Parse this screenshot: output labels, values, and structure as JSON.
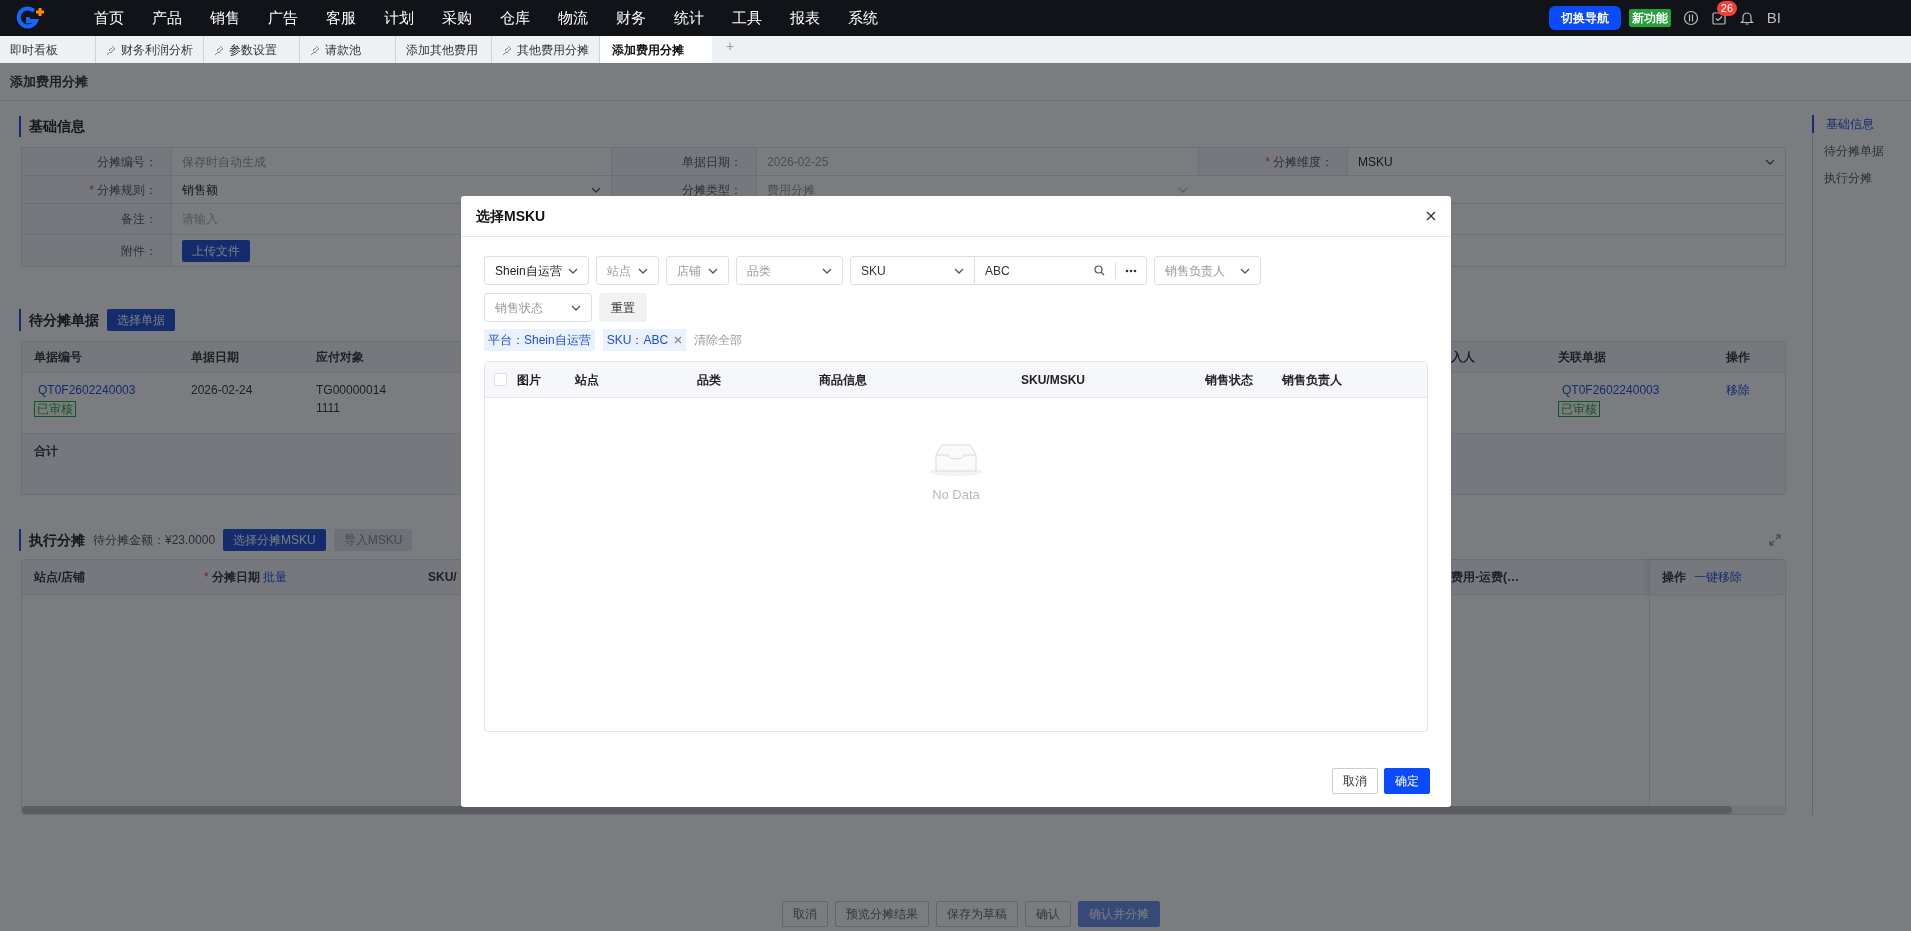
{
  "top_nav": {
    "items": [
      {
        "label": "首页",
        "selected": false
      },
      {
        "label": "产品",
        "selected": false
      },
      {
        "label": "销售",
        "selected": false
      },
      {
        "label": "广告",
        "selected": false
      },
      {
        "label": "客服",
        "selected": false
      },
      {
        "label": "计划",
        "selected": false
      },
      {
        "label": "采购",
        "selected": false
      },
      {
        "label": "仓库",
        "selected": false
      },
      {
        "label": "物流",
        "selected": false
      },
      {
        "label": "财务",
        "selected": false
      },
      {
        "label": "统计",
        "selected": false
      },
      {
        "label": "工具",
        "selected": false
      },
      {
        "label": "报表",
        "selected": false
      },
      {
        "label": "系统",
        "selected": false
      }
    ],
    "switch_button": "切换导航",
    "new_feature": "新功能",
    "notification_count": "26",
    "bi": "BI"
  },
  "tabs": [
    {
      "label": "即时看板",
      "pinned": false,
      "selected": false
    },
    {
      "label": "财务利润分析",
      "pinned": true,
      "selected": false
    },
    {
      "label": "参数设置",
      "pinned": true,
      "selected": false
    },
    {
      "label": "请款池",
      "pinned": true,
      "selected": false
    },
    {
      "label": "添加其他费用",
      "pinned": false,
      "selected": false
    },
    {
      "label": "其他费用分摊",
      "pinned": true,
      "selected": false
    },
    {
      "label": "添加费用分摊",
      "pinned": false,
      "selected": true
    }
  ],
  "add_tab": "+",
  "required_mark": "*",
  "page_title": "添加费用分摊",
  "anchor_nav": [
    {
      "label": "基础信息",
      "selected": true
    },
    {
      "label": "待分摊单据",
      "selected": false
    },
    {
      "label": "执行分摊",
      "selected": false
    }
  ],
  "basic_info": {
    "title": "基础信息",
    "rows": [
      [
        {
          "label": "分摊编号：",
          "kind": "text",
          "value": "保存时自动生成",
          "required": false,
          "disabled": true
        },
        {
          "label": "单据日期：",
          "kind": "text",
          "value": "2026-02-25",
          "required": false,
          "disabled": true
        },
        {
          "label": "分摊维度：",
          "kind": "select",
          "value": "MSKU",
          "required": true,
          "disabled": false
        }
      ],
      [
        {
          "label": "分摊规则：",
          "kind": "select",
          "value": "销售额",
          "required": true,
          "disabled": false
        },
        {
          "label": "分摊类型：",
          "kind": "select",
          "value": "费用分摊",
          "required": false,
          "disabled": true
        }
      ],
      [
        {
          "label": "备注：",
          "kind": "input",
          "placeholder": "请输入",
          "required": false,
          "disabled": false
        }
      ],
      [
        {
          "label": "附件：",
          "kind": "upload",
          "value": "上传文件",
          "required": false,
          "disabled": false
        }
      ]
    ]
  },
  "pending_docs": {
    "title": "待分摊单据",
    "select_button": "选择单据",
    "columns_left": [
      "单据编号",
      "单据日期",
      "应付对象"
    ],
    "columns_right": [
      "入人",
      "关联单据",
      "操作"
    ],
    "rows": [
      {
        "doc_no": "QT0F2602240003",
        "status": "已审核",
        "date": "2026-02-24",
        "payee_lines": [
          "TG00000014",
          "1111"
        ],
        "related_doc": "QT0F2602240003",
        "related_status": "已审核",
        "action": "移除"
      }
    ],
    "total_label": "合计"
  },
  "execute": {
    "title": "执行分摊",
    "amount": "待分摊金额：¥23.0000",
    "select_button": "选择分摊MSKU",
    "import_button": "导入MSKU",
    "columns_left": [
      {
        "label": "站点/店铺",
        "required": false
      },
      {
        "label": "分摊日期",
        "required": true,
        "link": "批量"
      },
      {
        "label": "SKU/",
        "required": false
      }
    ],
    "columns_right": [
      {
        "label": "费用-运费(…",
        "required": false
      }
    ],
    "fixed_column": {
      "label": "操作",
      "link": "一键移除"
    }
  },
  "footer_buttons": [
    {
      "label": "取消",
      "kind": "default"
    },
    {
      "label": "预览分摊结果",
      "kind": "default"
    },
    {
      "label": "保存为草稿",
      "kind": "default"
    },
    {
      "label": "确认",
      "kind": "default"
    },
    {
      "label": "确认并分摊",
      "kind": "primary"
    }
  ],
  "modal": {
    "title": "选择MSKU",
    "filters": [
      {
        "kind": "select",
        "value": "Shein自运营"
      },
      {
        "kind": "select",
        "placeholder": "站点"
      },
      {
        "kind": "select",
        "placeholder": "店铺"
      },
      {
        "kind": "select",
        "placeholder": "品类"
      },
      {
        "kind": "search",
        "field": "SKU",
        "value": "ABC"
      },
      {
        "kind": "select",
        "placeholder": "销售负责人"
      },
      {
        "kind": "select",
        "placeholder": "销售状态"
      }
    ],
    "reset_button": "重置",
    "tags": [
      {
        "label": "平台：Shein自运营",
        "closable": false
      },
      {
        "label": "SKU：ABC",
        "closable": true
      }
    ],
    "clear_all": "清除全部",
    "table": {
      "select_all_checked": false,
      "columns": [
        "图片",
        "站点",
        "品类",
        "商品信息",
        "SKU/MSKU",
        "销售状态",
        "销售负责人"
      ],
      "empty_text": "No Data"
    },
    "buttons": [
      {
        "label": "取消",
        "kind": "default"
      },
      {
        "label": "确定",
        "kind": "primary"
      }
    ]
  }
}
